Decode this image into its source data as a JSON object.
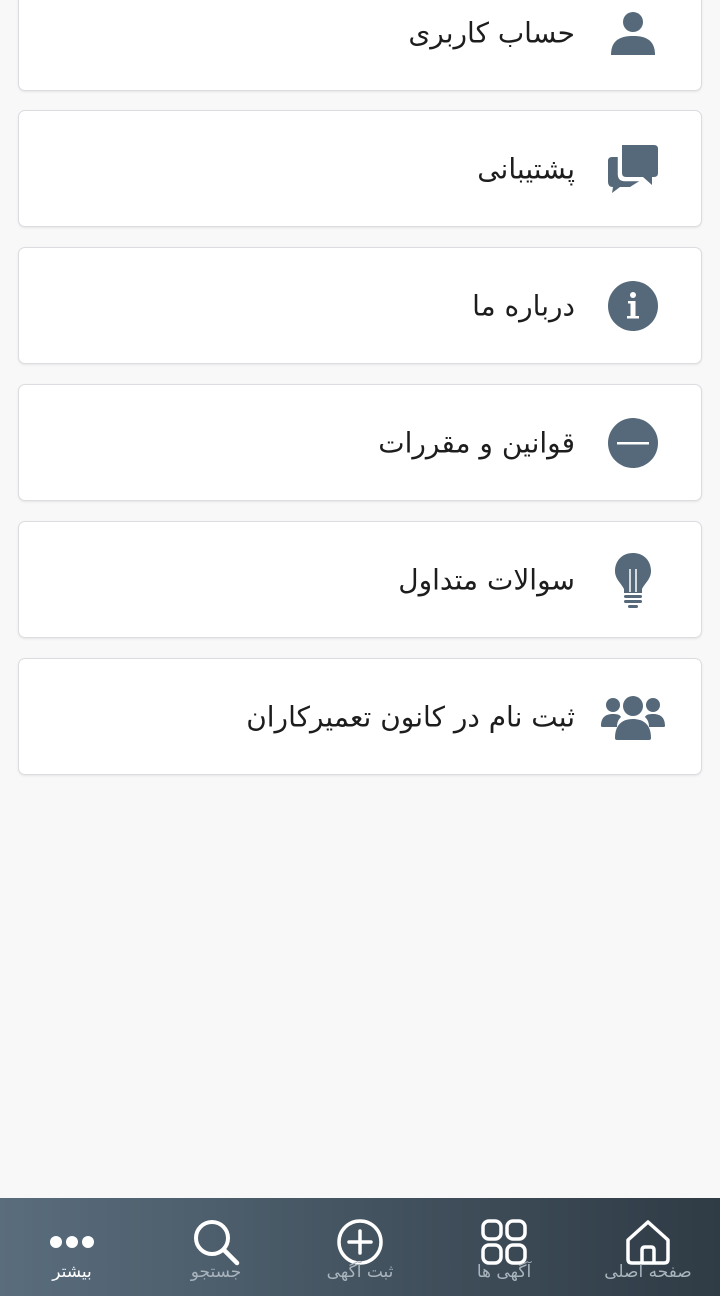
{
  "menu": {
    "items": [
      {
        "label": "حساب کاربری",
        "icon": "user-icon"
      },
      {
        "label": "پشتیبانی",
        "icon": "chat-bubbles-icon"
      },
      {
        "label": "درباره ما",
        "icon": "info-icon"
      },
      {
        "label": "قوانین و مقررات",
        "icon": "minus-circle-icon"
      },
      {
        "label": "سوالات متداول",
        "icon": "lightbulb-icon"
      },
      {
        "label": "ثبت نام در کانون تعمیرکاران",
        "icon": "users-group-icon"
      }
    ]
  },
  "bottom_nav": {
    "items": [
      {
        "label": "بیشتر",
        "icon": "more-dots-icon",
        "active": true
      },
      {
        "label": "جستجو",
        "icon": "search-icon",
        "active": false
      },
      {
        "label": "ثبت آگهی",
        "icon": "add-circle-icon",
        "active": false
      },
      {
        "label": "آگهی ها",
        "icon": "grid-icon",
        "active": false
      },
      {
        "label": "صفحه اصلی",
        "icon": "home-icon",
        "active": false
      }
    ]
  },
  "colors": {
    "icon": "#56697a",
    "nav_gradient_start": "#5a6d7d",
    "nav_gradient_end": "#2f3b45",
    "nav_active_text": "#ffffff",
    "nav_inactive_text": "#a9b4bd",
    "page_background": "#f8f8f8"
  }
}
